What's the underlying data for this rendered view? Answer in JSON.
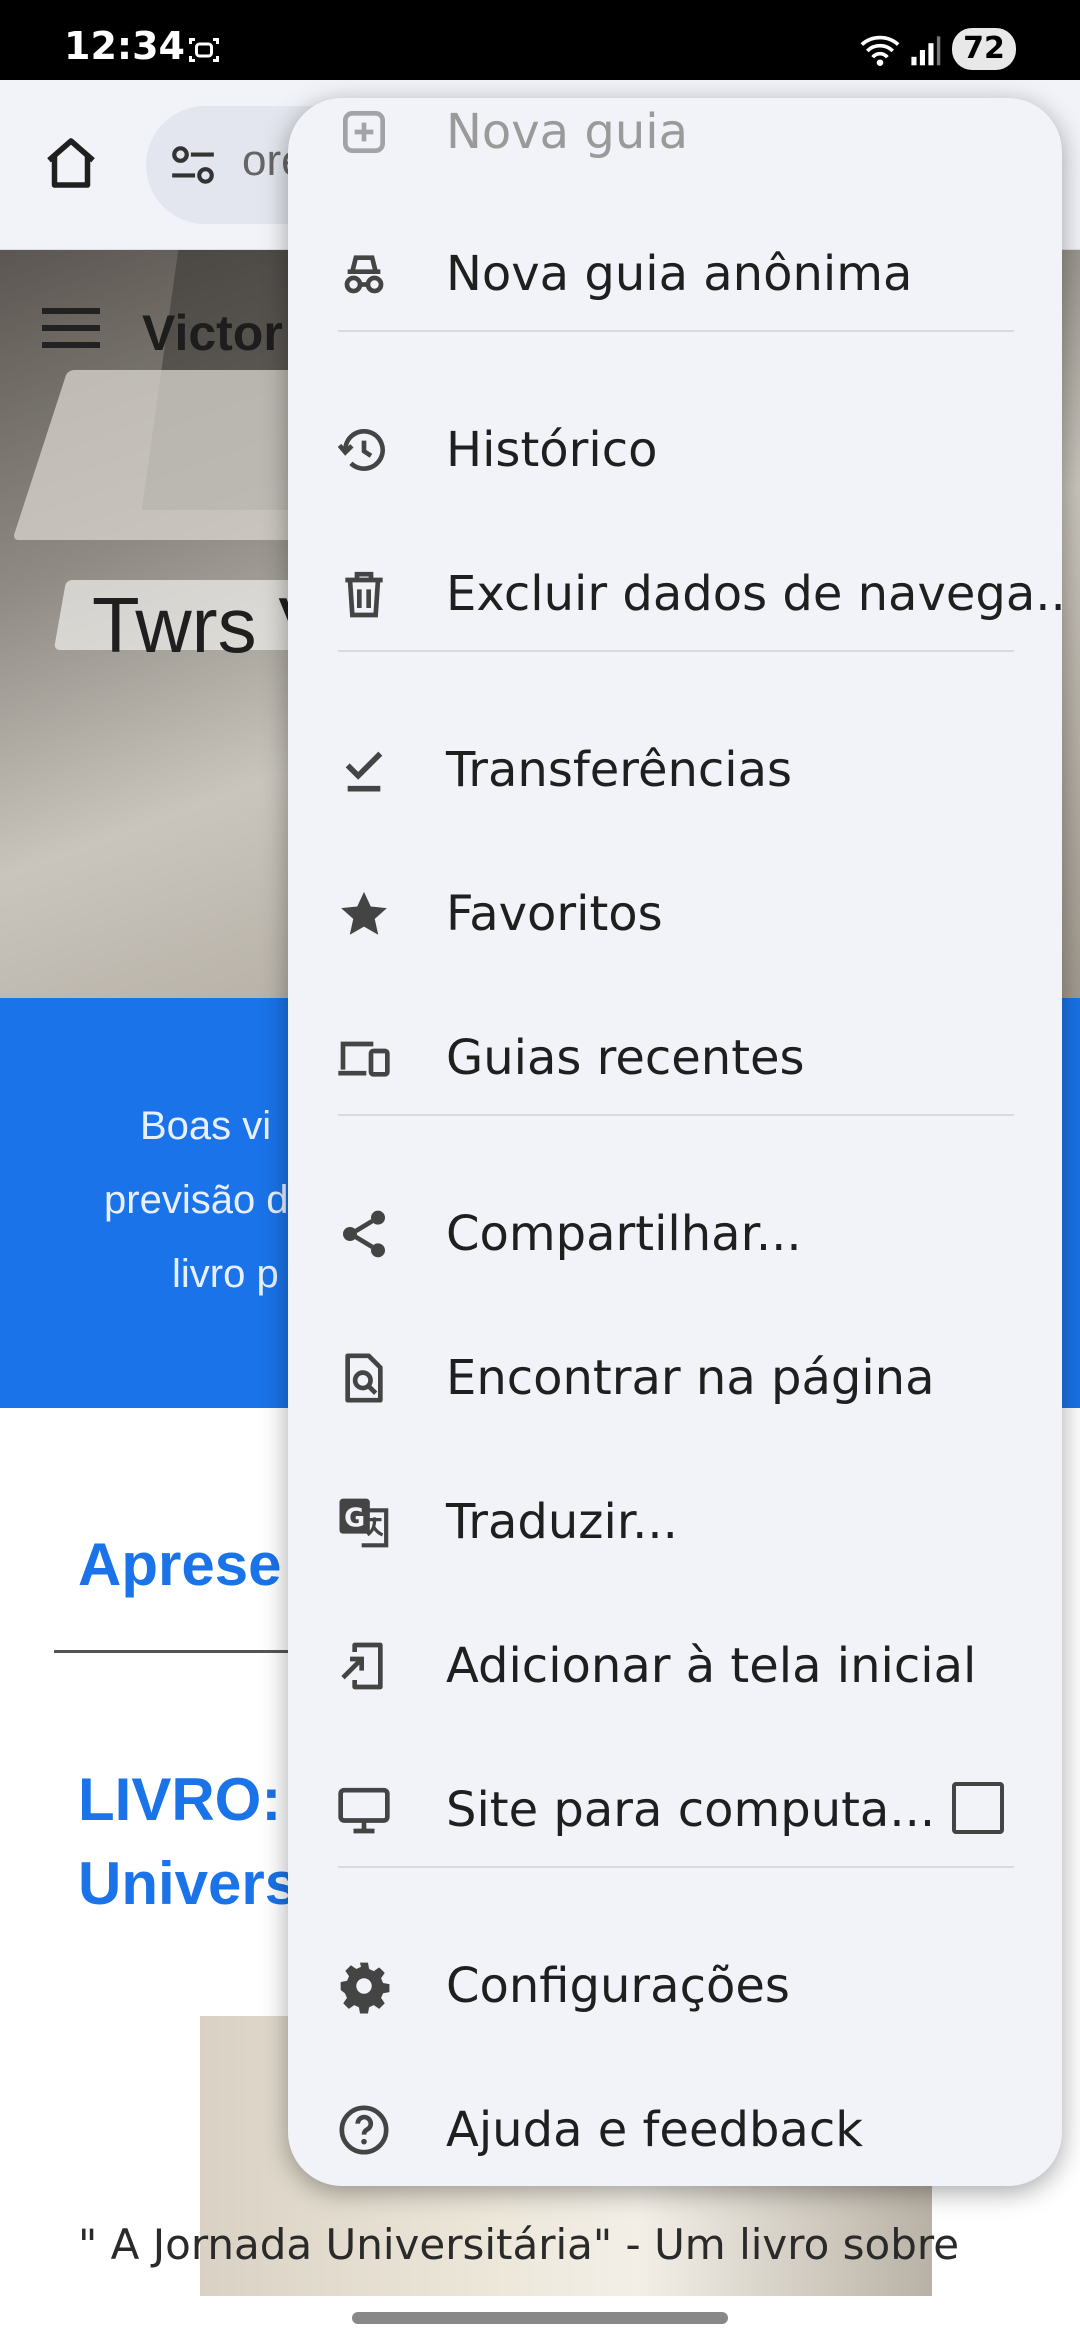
{
  "status_bar": {
    "time": "12:34",
    "battery": "72"
  },
  "toolbar": {
    "url_text": "ore"
  },
  "page": {
    "site_name": "Victor",
    "hero_title": "Twrs V",
    "banner_lines": [
      "Boas vi",
      "previsão d",
      "livro p"
    ],
    "section_heading": "Aprese",
    "book_title_lines": [
      "LIVRO:",
      "Univers"
    ],
    "book_caption": "\" A Jornada Universitária\" - Um livro sobre"
  },
  "menu": {
    "items": [
      {
        "label": "Nova guia",
        "icon": "new-tab-icon"
      },
      {
        "label": "Nova guia anônima",
        "icon": "incognito-icon"
      },
      {
        "label": "Histórico",
        "icon": "history-icon"
      },
      {
        "label": "Excluir dados de navega...",
        "icon": "trash-icon"
      },
      {
        "label": "Transferências",
        "icon": "download-check-icon"
      },
      {
        "label": "Favoritos",
        "icon": "star-icon"
      },
      {
        "label": "Guias recentes",
        "icon": "devices-icon"
      },
      {
        "label": "Compartilhar...",
        "icon": "share-icon"
      },
      {
        "label": "Encontrar na página",
        "icon": "find-in-page-icon"
      },
      {
        "label": "Traduzir...",
        "icon": "translate-icon"
      },
      {
        "label": "Adicionar à tela inicial",
        "icon": "add-to-home-icon"
      },
      {
        "label": "Site para computa...",
        "icon": "desktop-icon"
      },
      {
        "label": "Configurações",
        "icon": "settings-gear-icon"
      },
      {
        "label": "Ajuda e feedback",
        "icon": "help-icon"
      }
    ],
    "desktop_site_checked": false
  }
}
